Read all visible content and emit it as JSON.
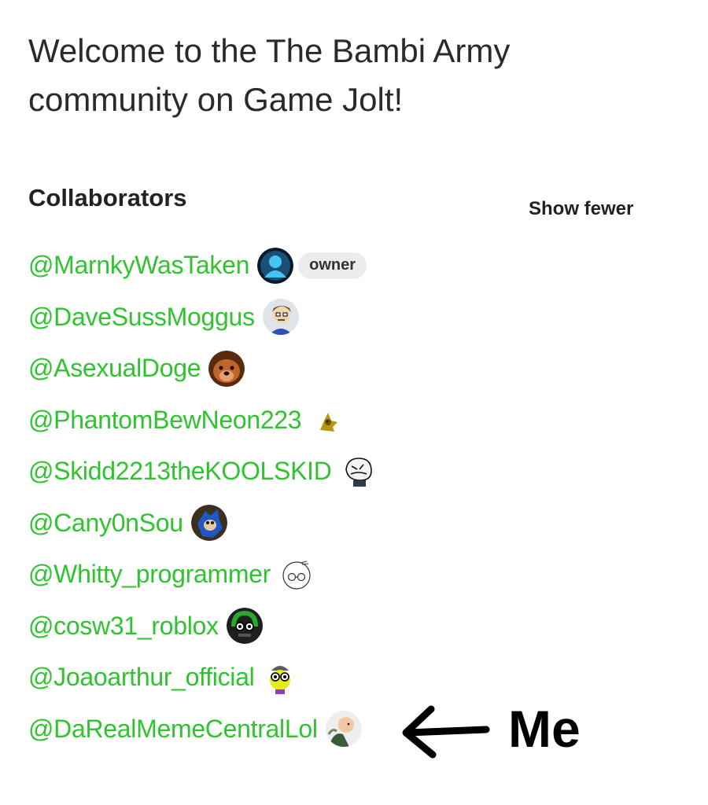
{
  "welcome_text": "Welcome to the The Bambi Army community on Game Jolt!",
  "collaborators": {
    "heading": "Collaborators",
    "toggle_label": "Show fewer",
    "owner_badge": "owner",
    "list": [
      {
        "handle": "@MarnkyWasTaken",
        "avatar_icon": "blue-silhouette-avatar"
      },
      {
        "handle": "@DaveSussMoggus",
        "avatar_icon": "cartoon-boy-avatar"
      },
      {
        "handle": "@AsexualDoge",
        "avatar_icon": "dog-avatar"
      },
      {
        "handle": "@PhantomBewNeon223",
        "avatar_icon": "yellow-creature-avatar"
      },
      {
        "handle": "@Skidd2213theKOOLSKID",
        "avatar_icon": "sketch-face-avatar"
      },
      {
        "handle": "@Cany0nSou",
        "avatar_icon": "blue-hedgehog-avatar"
      },
      {
        "handle": "@Whitty_programmer",
        "avatar_icon": "sketch-glasses-avatar"
      },
      {
        "handle": "@cosw31_roblox",
        "avatar_icon": "green-headset-avatar"
      },
      {
        "handle": "@Joaoarthur_official",
        "avatar_icon": "yellow-goggles-avatar"
      },
      {
        "handle": "@DaRealMemeCentralLol",
        "avatar_icon": "bald-character-avatar"
      }
    ]
  },
  "annotation": {
    "text": "Me",
    "icon": "hand-drawn-arrow-left-icon"
  },
  "colors": {
    "link_green": "#2fc42f",
    "text_dark": "#222222",
    "badge_bg": "#ececec"
  }
}
